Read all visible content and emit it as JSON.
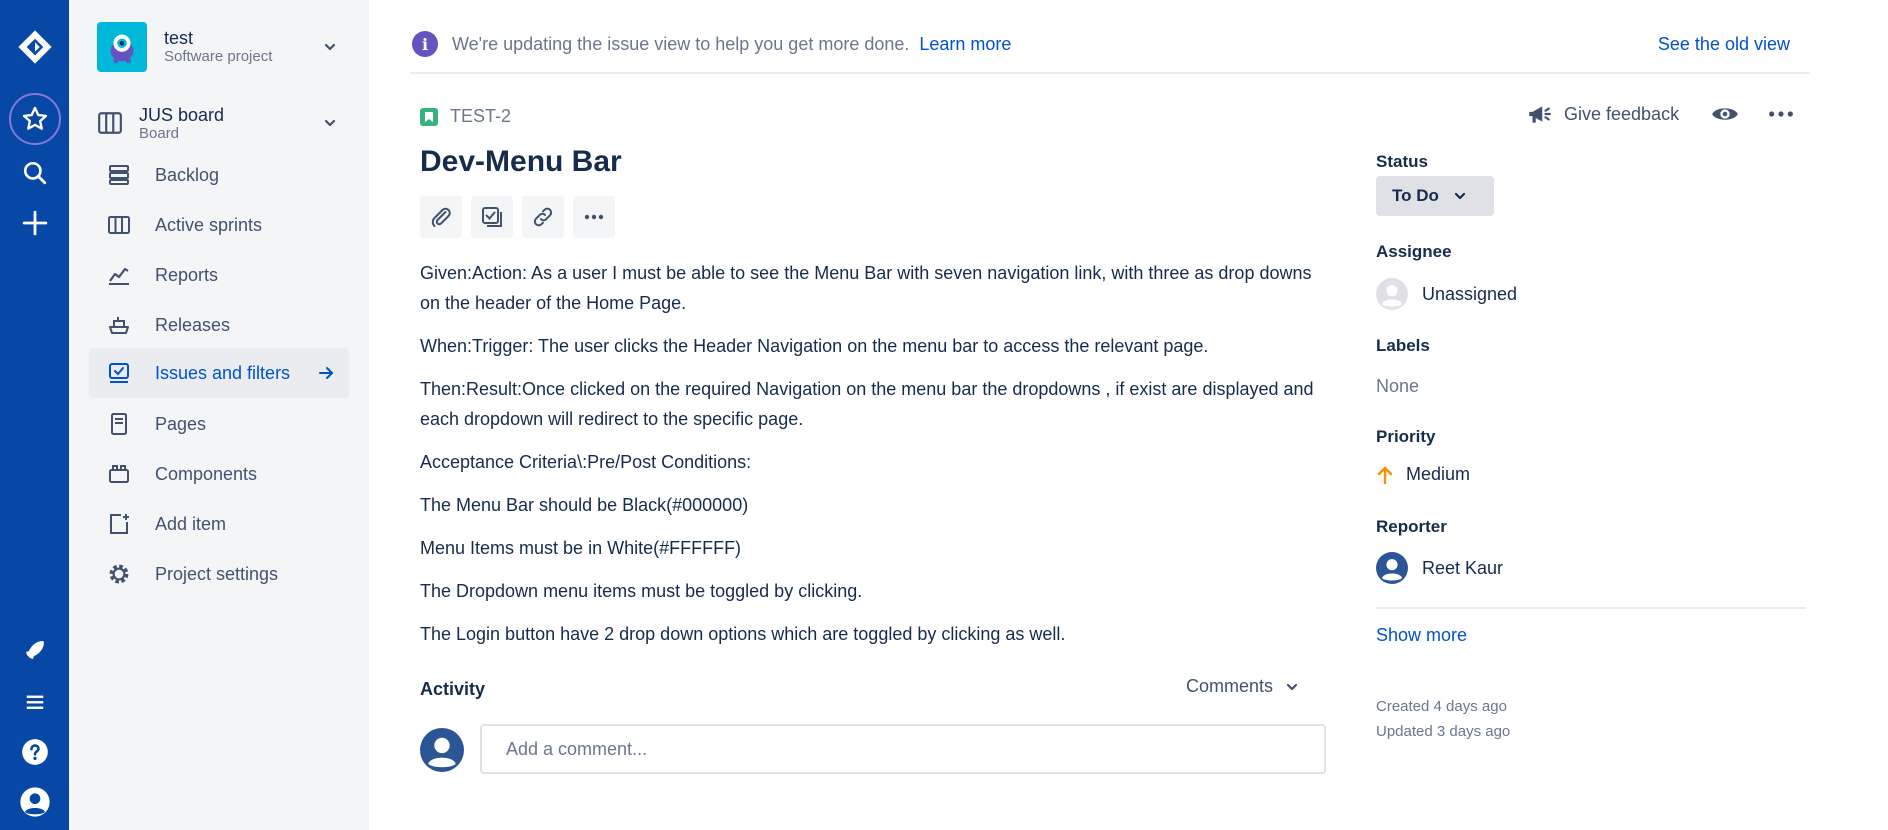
{
  "colors": {
    "global_nav": "#0747a6",
    "sidebar_bg": "#f4f5f7",
    "link": "#0052cc",
    "story": "#36b37e",
    "info": "#6554c0",
    "priority_medium": "#ff8b00"
  },
  "global_nav": {
    "icons": [
      "jira-logo-icon",
      "starred-icon",
      "search-icon",
      "create-icon",
      "rocket-icon",
      "menu-icon",
      "help-icon",
      "profile-icon"
    ]
  },
  "sidebar": {
    "project_name": "test",
    "project_type": "Software project",
    "board_name": "JUS board",
    "board_sub": "Board",
    "items": [
      {
        "label": "Backlog",
        "icon": "backlog-icon"
      },
      {
        "label": "Active sprints",
        "icon": "board-columns-icon"
      },
      {
        "label": "Reports",
        "icon": "graph-icon"
      },
      {
        "label": "Releases",
        "icon": "ship-icon"
      },
      {
        "label": "Issues and filters",
        "icon": "issues-icon",
        "active": true
      },
      {
        "label": "Pages",
        "icon": "page-icon"
      },
      {
        "label": "Components",
        "icon": "component-icon"
      },
      {
        "label": "Add item",
        "icon": "add-item-icon"
      },
      {
        "label": "Project settings",
        "icon": "settings-icon"
      }
    ]
  },
  "banner": {
    "text": "We're updating the issue view to help you get more done.",
    "learn_more": "Learn more",
    "old_view": "See the old view"
  },
  "issue": {
    "key": "TEST-2",
    "title": "Dev-Menu Bar",
    "description": [
      "Given:Action: As a user I must be able to see the Menu Bar with seven navigation link, with three as drop downs on the header of the Home Page.",
      "When:Trigger: The user clicks the Header Navigation on the menu bar to access the relevant page.",
      "Then:Result:Once clicked on the required Navigation on the menu bar the dropdowns , if exist are displayed and each dropdown will redirect to the specific page.",
      "Acceptance Criteria\\:Pre/Post Conditions:",
      "The Menu Bar should be Black(#000000)",
      "Menu Items must be in White(#FFFFFF)",
      "The Dropdown menu items must be toggled by clicking.",
      "The Login button have 2 drop down options which are toggled by clicking as well."
    ]
  },
  "activity": {
    "title": "Activity",
    "filter": "Comments",
    "comment_placeholder": "Add a comment..."
  },
  "details": {
    "give_feedback": "Give feedback",
    "status_label": "Status",
    "status_value": "To Do",
    "assignee_label": "Assignee",
    "assignee_value": "Unassigned",
    "labels_label": "Labels",
    "labels_value": "None",
    "priority_label": "Priority",
    "priority_value": "Medium",
    "reporter_label": "Reporter",
    "reporter_value": "Reet Kaur",
    "show_more": "Show more",
    "created": "Created 4 days ago",
    "updated": "Updated 3 days ago"
  }
}
